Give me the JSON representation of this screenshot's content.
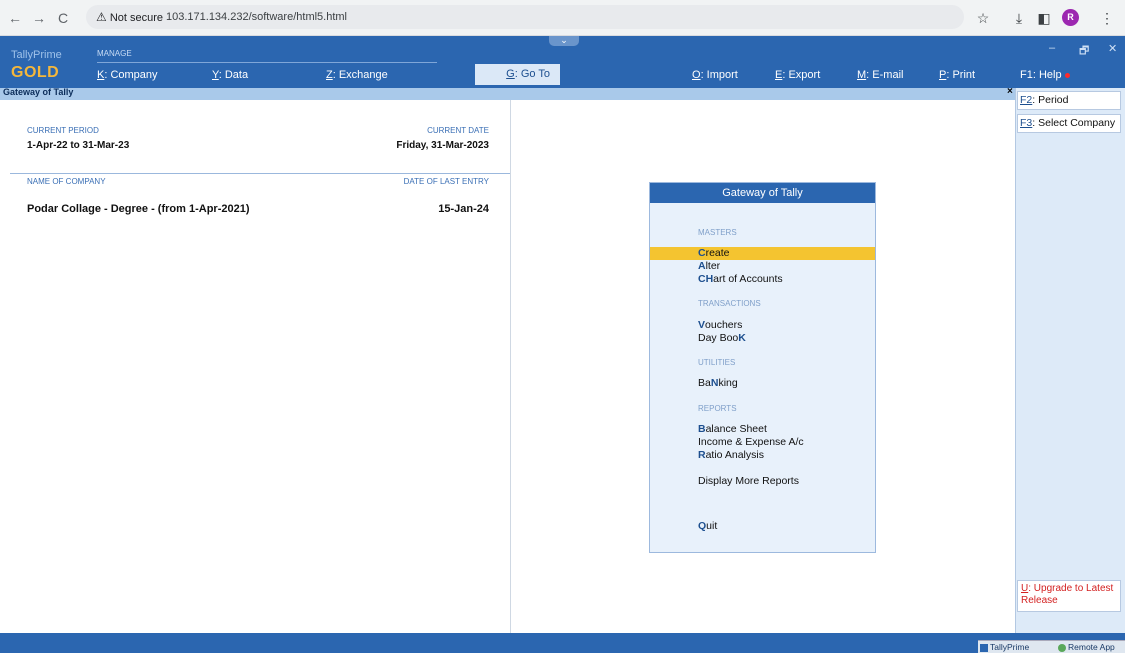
{
  "browser": {
    "back": "←",
    "forward": "→",
    "reload": "C",
    "warning_icon": "⚠",
    "not_secure": "Not secure",
    "url": "103.171.134.232/software/html5.html",
    "profile_initial": "R"
  },
  "header": {
    "brand_name": "TallyPrime",
    "brand_edition": "GOLD",
    "manage_label": "MANAGE",
    "menus": {
      "company": {
        "key": "K",
        "label": ": Company"
      },
      "data": {
        "key": "Y",
        "label": ": Data"
      },
      "exchange": {
        "key": "Z",
        "label": ": Exchange"
      },
      "goto": {
        "key": "G",
        "label": ": Go To"
      },
      "import": {
        "key": "O",
        "label": ": Import"
      },
      "export": {
        "key": "E",
        "label": ": Export"
      },
      "email": {
        "key": "M",
        "label": ": E-mail"
      },
      "print": {
        "key": "P",
        "label": ": Print"
      },
      "help": {
        "key": "F1",
        "label": ": Help"
      }
    },
    "collapse_glyph": "⌄"
  },
  "title_bar": {
    "title": "Gateway of Tally",
    "close": "×"
  },
  "left_panel": {
    "current_period_label": "CURRENT PERIOD",
    "current_period_value": "1-Apr-22 to 31-Mar-23",
    "current_date_label": "CURRENT DATE",
    "current_date_value": "Friday, 31-Mar-2023",
    "name_of_company_label": "NAME OF COMPANY",
    "date_of_last_entry_label": "DATE OF LAST ENTRY",
    "company_name": "Podar Collage - Degree - (from 1-Apr-2021)",
    "last_entry_date": "15-Jan-24"
  },
  "gateway": {
    "title": "Gateway of Tally",
    "sections": {
      "masters": "MASTERS",
      "transactions": "TRANSACTIONS",
      "utilities": "UTILITIES",
      "reports": "REPORTS"
    },
    "items": {
      "create": {
        "hk": "C",
        "rest": "reate"
      },
      "alter": {
        "hk": "A",
        "rest": "lter"
      },
      "chart": {
        "hk": "CH",
        "rest": "art of Accounts"
      },
      "vouchers": {
        "hk": "V",
        "rest": "ouchers"
      },
      "daybook_pre": "Day Boo",
      "daybook_hk": "K",
      "banking_pre": "Ba",
      "banking_hk": "N",
      "banking_rest": "king",
      "balance": {
        "hk": "B",
        "rest": "alance Sheet"
      },
      "income_pre": "Income & Expense A/c",
      "ratio": {
        "hk": "R",
        "rest": "atio Analysis"
      },
      "display_more_pre": "Display More Reports",
      "quit_hk": "Q",
      "quit_rest": "uit"
    }
  },
  "sidebar": {
    "period": {
      "key": "F2",
      "label": ": Period"
    },
    "select_company": {
      "key": "F3",
      "label": ": Select Company"
    },
    "upgrade": {
      "key": "U",
      "label": ": Upgrade to Latest Release"
    }
  },
  "taskbar": {
    "tallyprime": "TallyPrime",
    "remote_app": "Remote App"
  },
  "colors": {
    "tally_blue": "#2b66b0",
    "gold": "#f4b73c",
    "highlight": "#f4c430"
  }
}
